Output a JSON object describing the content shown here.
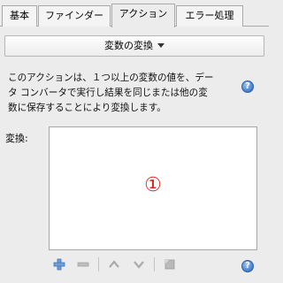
{
  "tabs": [
    {
      "label": "基本"
    },
    {
      "label": "ファインダー"
    },
    {
      "label": "アクション",
      "active": true
    },
    {
      "label": "エラー処理"
    }
  ],
  "dropdown": {
    "label": "変数の変換"
  },
  "description": {
    "lines": [
      "このアクションは、１つ以上の変数の値を、デー",
      "タ コンバータで実行し結果を同じまたは他の変",
      "数に保存することにより変換します。"
    ]
  },
  "help_glyph": "?",
  "transform": {
    "label": "変換:",
    "marker": "①",
    "items": []
  },
  "toolbar": {
    "buttons": [
      "add",
      "remove",
      "move-up",
      "move-down",
      "edit"
    ]
  },
  "colors": {
    "marker": "#e02020",
    "help": "#3b78c8"
  }
}
